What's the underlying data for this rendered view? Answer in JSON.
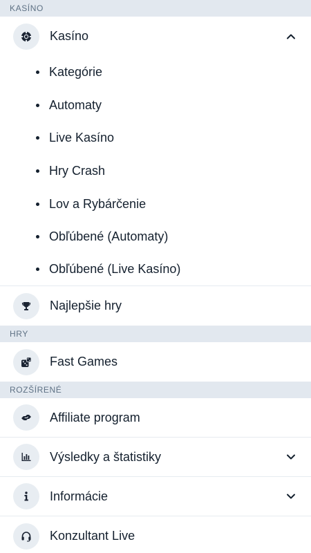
{
  "sections": {
    "casino": {
      "header": "KASÍNO",
      "main_item": {
        "label": "Kasíno",
        "icon": "casino-chip-icon",
        "expanded": true
      },
      "sub_items": [
        "Kategórie",
        "Automaty",
        "Live Kasíno",
        "Hry Crash",
        "Lov a Rybárčenie",
        "Obľúbené (Automaty)",
        "Obľúbené (Live Kasíno)"
      ],
      "top_games": {
        "label": "Najlepšie hry",
        "icon": "trophy-icon"
      }
    },
    "games": {
      "header": "HRY",
      "fast_games": {
        "label": "Fast Games",
        "icon": "dice-icon"
      }
    },
    "extended": {
      "header": "ROZŠÍRENÉ",
      "affiliate": {
        "label": "Affiliate program",
        "icon": "handshake-icon"
      },
      "results": {
        "label": "Výsledky a štatistiky",
        "icon": "bar-chart-icon"
      },
      "info": {
        "label": "Informácie",
        "icon": "info-icon"
      },
      "support": {
        "label": "Konzultant Live",
        "icon": "headset-icon"
      }
    }
  },
  "colors": {
    "section_bg": "#e2e8ef",
    "section_text": "#5e7184",
    "icon_bg": "#e8edf2",
    "text": "#14202e"
  }
}
